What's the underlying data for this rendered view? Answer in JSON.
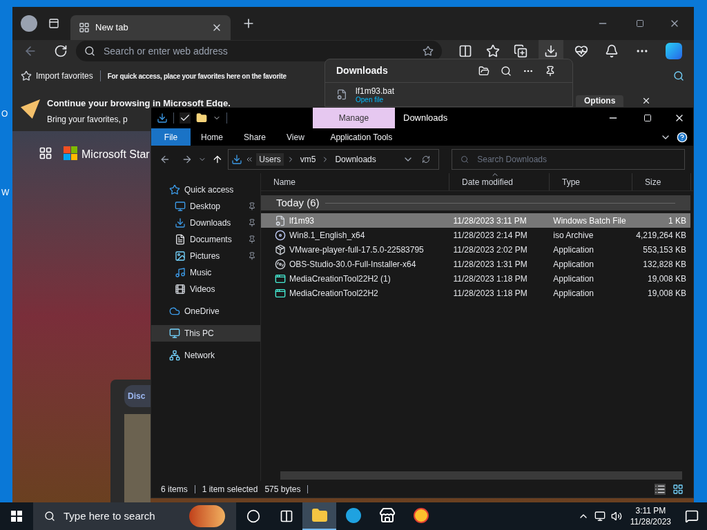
{
  "desktop": {
    "icon_labels": [
      "O",
      "W"
    ]
  },
  "browser": {
    "tabs": [
      {
        "title": "New tab",
        "selected": true
      }
    ],
    "address_placeholder": "Search or enter web address",
    "favorites_bar": {
      "import": "Import favorites",
      "hint": "For quick access, place your favorites here on the favorite"
    },
    "banner": {
      "title": "Continue your browsing in Microsoft Edge.",
      "text": "Bring your favorites, p",
      "options": "Options"
    },
    "page": {
      "brand": "Microsoft Star",
      "discover": "Disc"
    },
    "downloads_panel": {
      "title": "Downloads",
      "items": [
        {
          "name": "lf1m93.bat",
          "action": "Open file"
        }
      ]
    }
  },
  "explorer": {
    "context_tab": "Manage",
    "title": "Downloads",
    "ribbon_tabs": [
      {
        "label": "File",
        "kind": "file"
      },
      {
        "label": "Home",
        "kind": "normal"
      },
      {
        "label": "Share",
        "kind": "normal"
      },
      {
        "label": "View",
        "kind": "normal"
      },
      {
        "label": "Application Tools",
        "kind": "context"
      }
    ],
    "breadcrumb": [
      "Users",
      "vm5",
      "Downloads"
    ],
    "search_placeholder": "Search Downloads",
    "nav": [
      {
        "label": "Quick access",
        "kind": "quick",
        "pinned": false,
        "selected": false
      },
      {
        "label": "Desktop",
        "kind": "desktop",
        "pinned": true,
        "selected": false
      },
      {
        "label": "Downloads",
        "kind": "downloads",
        "pinned": true,
        "selected": false
      },
      {
        "label": "Documents",
        "kind": "documents",
        "pinned": true,
        "selected": false
      },
      {
        "label": "Pictures",
        "kind": "pictures",
        "pinned": true,
        "selected": false
      },
      {
        "label": "Music",
        "kind": "music",
        "pinned": false,
        "selected": false
      },
      {
        "label": "Videos",
        "kind": "videos",
        "pinned": false,
        "selected": false
      },
      {
        "label": "OneDrive",
        "kind": "onedrive",
        "pinned": false,
        "selected": false
      },
      {
        "label": "This PC",
        "kind": "pc",
        "pinned": false,
        "selected": true
      },
      {
        "label": "Network",
        "kind": "network",
        "pinned": false,
        "selected": false
      }
    ],
    "columns": [
      {
        "label": "Name",
        "sorted": false
      },
      {
        "label": "Date modified",
        "sorted": true
      },
      {
        "label": "Type",
        "sorted": false
      },
      {
        "label": "Size",
        "sorted": false
      }
    ],
    "group": {
      "label": "Today (6)",
      "expanded": true
    },
    "rows": [
      {
        "name": "lf1m93",
        "date": "11/28/2023 3:11 PM",
        "type": "Windows Batch File",
        "size": "1 KB",
        "kind": "batch",
        "selected": true
      },
      {
        "name": "Win8.1_English_x64",
        "date": "11/28/2023 2:14 PM",
        "type": "iso Archive",
        "size": "4,219,264 KB",
        "kind": "iso",
        "selected": false
      },
      {
        "name": "VMware-player-full-17.5.0-22583795",
        "date": "11/28/2023 2:02 PM",
        "type": "Application",
        "size": "553,153 KB",
        "kind": "installer",
        "selected": false
      },
      {
        "name": "OBS-Studio-30.0-Full-Installer-x64",
        "date": "11/28/2023 1:31 PM",
        "type": "Application",
        "size": "132,828 KB",
        "kind": "disc",
        "selected": false
      },
      {
        "name": "MediaCreationTool22H2 (1)",
        "date": "11/28/2023 1:18 PM",
        "type": "Application",
        "size": "19,008 KB",
        "kind": "setup",
        "selected": false
      },
      {
        "name": "MediaCreationTool22H2",
        "date": "11/28/2023 1:18 PM",
        "type": "Application",
        "size": "19,008 KB",
        "kind": "setup",
        "selected": false
      }
    ],
    "status": {
      "count": "6 items",
      "selection": "1 item selected",
      "bytes": "575 bytes"
    }
  },
  "taskbar": {
    "search_placeholder": "Type here to search",
    "apps": [
      {
        "kind": "explorer",
        "selected": true
      },
      {
        "kind": "edge",
        "selected": false
      },
      {
        "kind": "store",
        "selected": false
      },
      {
        "kind": "chrome",
        "selected": false
      }
    ],
    "time": "3:11 PM",
    "date": "11/28/2023"
  }
}
